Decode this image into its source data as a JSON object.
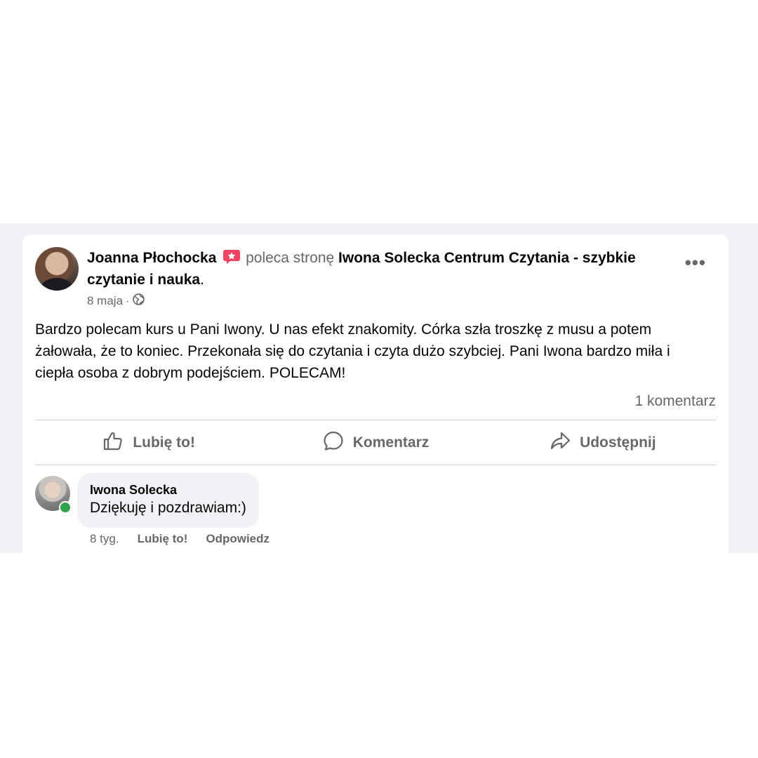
{
  "post": {
    "author": "Joanna Płochocka",
    "verb": "poleca stronę",
    "page_name": "Iwona Solecka Centrum Czytania - szybkie czytanie i nauka",
    "period": ".",
    "date": "8 maja",
    "separator": "·",
    "privacy_icon": "globe-icon",
    "recommend_icon": "recommend-star-icon",
    "recommend_color": "#f3425f",
    "more_label": "•••",
    "text": "Bardzo polecam kurs u Pani Iwony. U nas efekt znakomity. Córka szła troszkę z musu a potem żałowała, że to koniec. Przekonała się do czytania i czyta dużo szybciej. Pani Iwona bardzo miła i ciepła osoba z dobrym podejściem. POLECAM!",
    "comment_count": "1 komentarz"
  },
  "actions": {
    "like": "Lubię to!",
    "comment": "Komentarz",
    "share": "Udostępnij"
  },
  "comment": {
    "author": "Iwona Solecka",
    "text": "Dziękuję i pozdrawiam:)",
    "time": "8 tyg.",
    "like": "Lubię to!",
    "reply": "Odpowiedz",
    "online_color": "#31a24c"
  }
}
